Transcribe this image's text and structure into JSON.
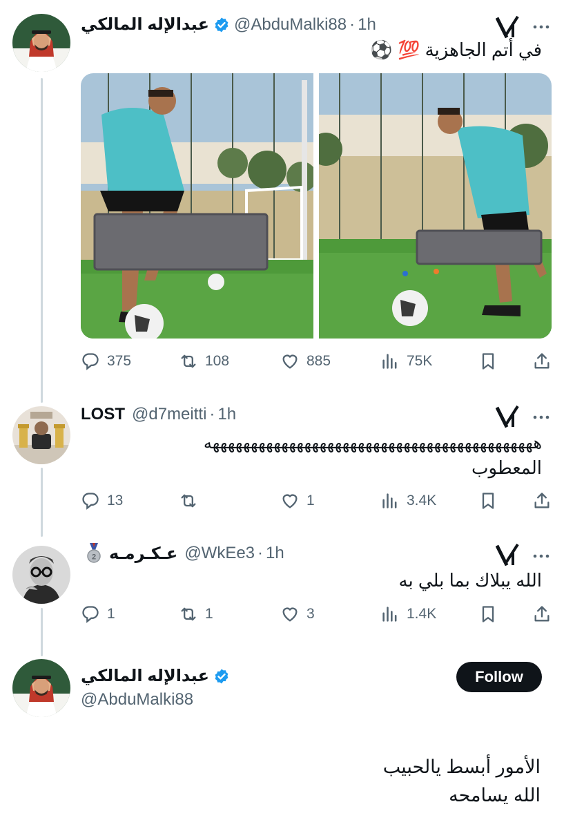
{
  "posts": [
    {
      "name": "عبدالإله المالكي",
      "handle": "@AbduMalki88",
      "time": "1h",
      "text": "في أتم الجاهزية 💯 ⚽️",
      "replies": "375",
      "reposts": "108",
      "likes": "885",
      "views": "75K"
    },
    {
      "name": "LOST",
      "handle": "@d7meitti",
      "time": "1h",
      "text_line1": "هههههههههههههههههههههههههههههههههههههههههههه",
      "text_line2": "المعطوب",
      "replies": "13",
      "reposts": "",
      "likes": "1",
      "views": "3.4K"
    },
    {
      "name": "عـكـرمـه",
      "handle": "@WkEe3",
      "time": "1h",
      "text": "الله يبلاك بما بلي به",
      "replies": "1",
      "reposts": "1",
      "likes": "3",
      "views": "1.4K"
    }
  ],
  "reply": {
    "name": "عبدالإله المالكي",
    "handle": "@AbduMalki88",
    "follow_label": "Follow",
    "text_line1": "الأمور أبسط يالحبيب",
    "text_line2": "الله يسامحه"
  },
  "colors": {
    "verified": "#1d9bf0",
    "text": "#0f1419",
    "secondary": "#536471",
    "thread_line": "#cfd9de",
    "follow_bg": "#0f1419"
  },
  "icons": {
    "reply": "comment-icon",
    "repost": "repost-icon",
    "like": "heart-icon",
    "views": "views-icon",
    "bookmark": "bookmark-icon",
    "share": "share-icon",
    "grok": "grok-icon",
    "more": "more-icon"
  }
}
